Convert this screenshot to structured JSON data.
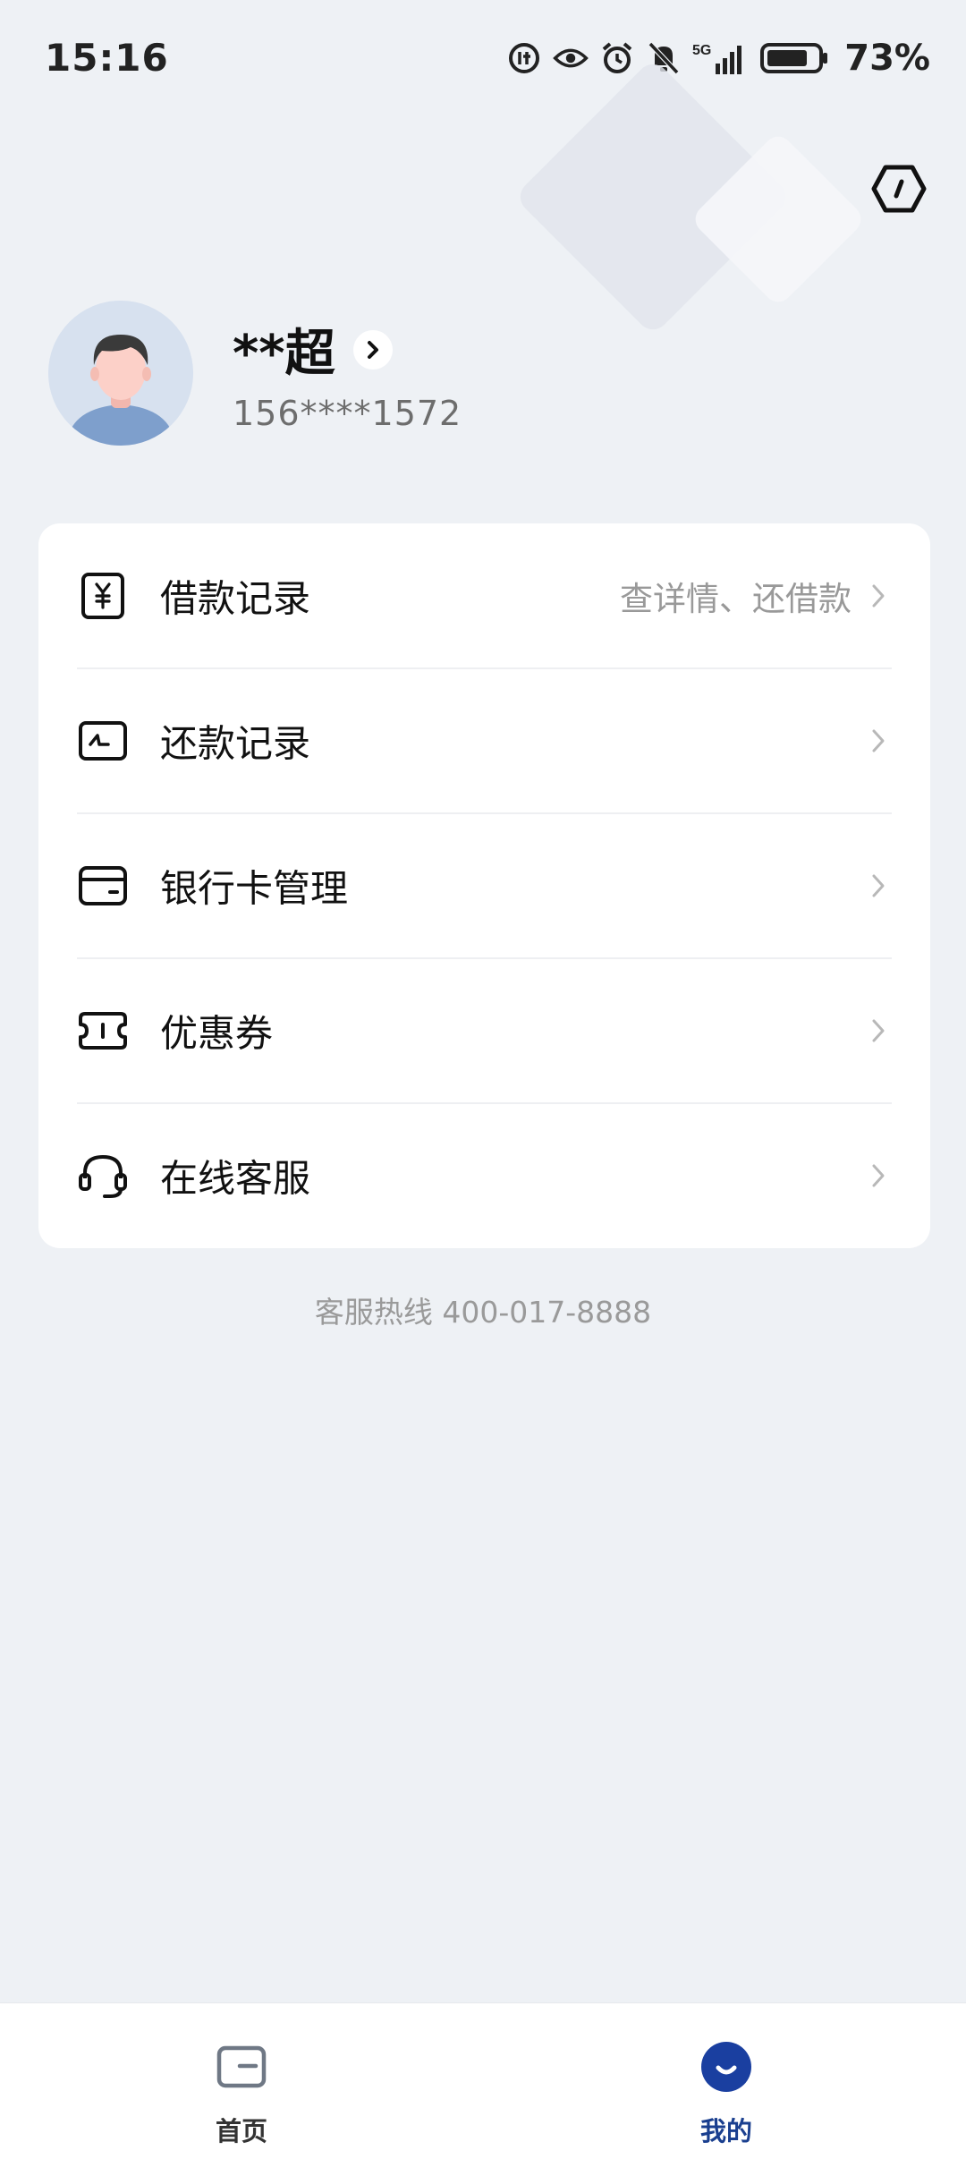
{
  "status_bar": {
    "time": "15:16",
    "network": "5G",
    "battery_percent": "73%",
    "icons": [
      "data-saver-icon",
      "eye-icon",
      "alarm-icon",
      "bell-off-icon",
      "signal-icon",
      "battery-icon"
    ]
  },
  "header": {
    "settings_icon": "hexagon-settings-icon"
  },
  "profile": {
    "name": "**超",
    "phone": "156****1572"
  },
  "menu": {
    "items": [
      {
        "label": "借款记录",
        "hint": "查详情、还借款",
        "icon": "loan-yuan-icon"
      },
      {
        "label": "还款记录",
        "hint": "",
        "icon": "repayment-icon"
      },
      {
        "label": "银行卡管理",
        "hint": "",
        "icon": "bank-card-icon"
      },
      {
        "label": "优惠券",
        "hint": "",
        "icon": "coupon-icon"
      },
      {
        "label": "在线客服",
        "hint": "",
        "icon": "headset-icon"
      }
    ]
  },
  "footer": {
    "hotline": "客服热线 400-017-8888"
  },
  "bottom_nav": {
    "items": [
      {
        "label": "首页",
        "active": false,
        "icon": "home-wallet-icon"
      },
      {
        "label": "我的",
        "active": true,
        "icon": "profile-smile-icon"
      }
    ]
  },
  "colors": {
    "background": "#eef1f5",
    "accent": "#1a3f8f",
    "card": "#ffffff"
  }
}
